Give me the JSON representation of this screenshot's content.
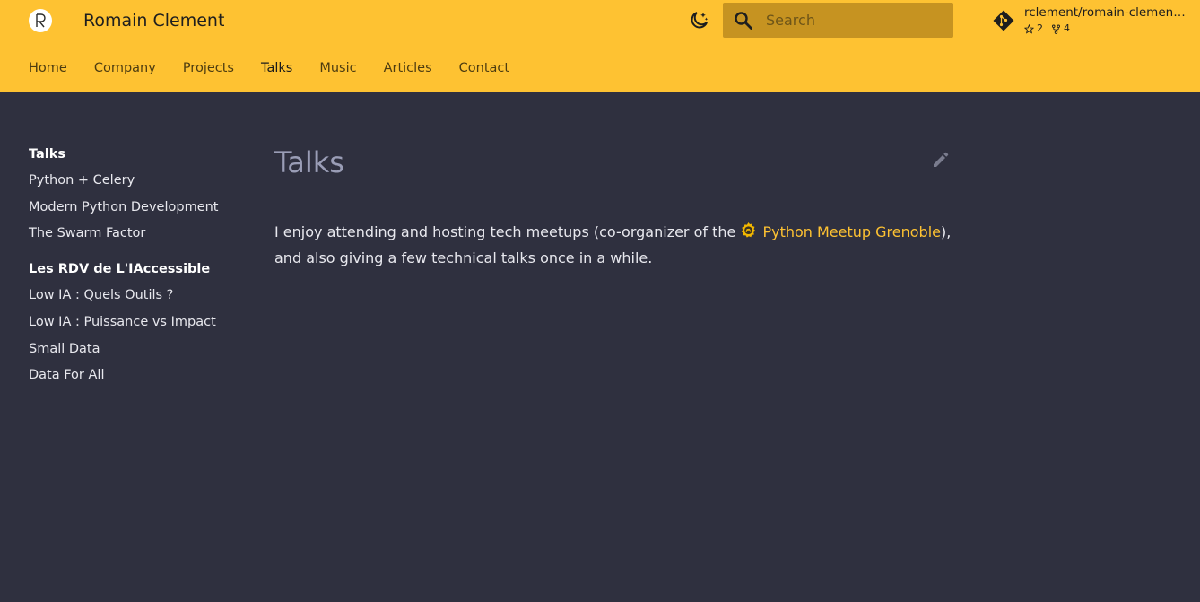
{
  "header": {
    "site_title": "Romain Clement",
    "logo_icon": "romain-clement-logo-icon",
    "theme_toggle_icon": "moon-star-icon",
    "search": {
      "placeholder": "Search",
      "value": "",
      "icon": "search-icon"
    },
    "repo": {
      "icon": "git-icon",
      "name": "rclement/romain-clement.net",
      "stars": "2",
      "forks": "4",
      "star_icon": "star-icon",
      "fork_icon": "fork-icon"
    },
    "accent_color": "#fec232"
  },
  "tabs": [
    {
      "label": "Home",
      "active": false
    },
    {
      "label": "Company",
      "active": false
    },
    {
      "label": "Projects",
      "active": false
    },
    {
      "label": "Talks",
      "active": true
    },
    {
      "label": "Music",
      "active": false
    },
    {
      "label": "Articles",
      "active": false
    },
    {
      "label": "Contact",
      "active": false
    }
  ],
  "sidebar": {
    "sections": [
      {
        "title": "Talks",
        "items": [
          "Python + Celery",
          "Modern Python Development",
          "The Swarm Factor"
        ]
      },
      {
        "title": "Les RDV de L'IAccessible",
        "items": [
          "Low IA : Quels Outils ?",
          "Low IA : Puissance vs Impact",
          "Small Data",
          "Data For All"
        ]
      }
    ]
  },
  "main": {
    "title": "Talks",
    "edit_icon": "pencil-icon",
    "paragraph": {
      "before_link": "I enjoy attending and hosting tech meetups (co-organizer of the ",
      "link_icon": "meetup-badge-icon",
      "link_text": "Python Meetup Grenoble",
      "after_link": "),",
      "line2": "and also giving a few technical talks once in a while."
    }
  },
  "colors": {
    "background": "#2f303f",
    "header": "#fec232",
    "search_bg": "#c69321",
    "title_muted": "#9a9db6"
  }
}
